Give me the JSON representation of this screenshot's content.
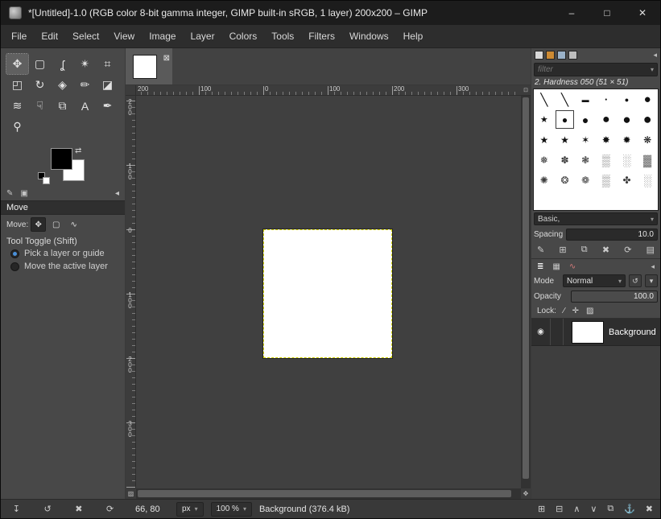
{
  "titlebar": {
    "title": "*[Untitled]-1.0 (RGB color 8-bit gamma integer, GIMP built-in sRGB, 1 layer) 200x200 – GIMP",
    "minimize": "–",
    "maximize": "□",
    "close": "✕"
  },
  "menubar": {
    "items": [
      "File",
      "Edit",
      "Select",
      "View",
      "Image",
      "Layer",
      "Colors",
      "Tools",
      "Filters",
      "Windows",
      "Help"
    ]
  },
  "toolbox": {
    "tools": [
      {
        "name": "move",
        "glyph": "✥"
      },
      {
        "name": "rectangle-select",
        "glyph": "▢"
      },
      {
        "name": "free-select",
        "glyph": "ʆ"
      },
      {
        "name": "fuzzy-select",
        "glyph": "✴"
      },
      {
        "name": "crop",
        "glyph": "⌗"
      },
      {
        "name": "align",
        "glyph": "◰"
      },
      {
        "name": "rotate",
        "glyph": "↻"
      },
      {
        "name": "bucket-fill",
        "glyph": "◈"
      },
      {
        "name": "pencil",
        "glyph": "✏"
      },
      {
        "name": "eraser",
        "glyph": "◪"
      },
      {
        "name": "airbrush",
        "glyph": "≋"
      },
      {
        "name": "smudge",
        "glyph": "☟"
      },
      {
        "name": "clone",
        "glyph": "⧉"
      },
      {
        "name": "text",
        "glyph": "A"
      },
      {
        "name": "ink",
        "glyph": "✒"
      },
      {
        "name": "zoom",
        "glyph": "⚲"
      }
    ],
    "colors": {
      "foreground": "#000000",
      "background": "#ffffff",
      "swap_icon": "⇄"
    },
    "dock_tabs": [
      {
        "name": "tool-options-tab",
        "glyph": "✎"
      },
      {
        "name": "device-status-tab",
        "glyph": "▣"
      }
    ],
    "dock_collapse_icon": "◂",
    "options": {
      "title": "Move",
      "move_label": "Move:",
      "targets": [
        {
          "name": "move-layer",
          "glyph": "✥"
        },
        {
          "name": "move-selection",
          "glyph": "▢"
        },
        {
          "name": "move-path",
          "glyph": "∿"
        }
      ],
      "tool_toggle": "Tool Toggle (Shift)",
      "radios": [
        {
          "label": "Pick a layer or guide",
          "selected": true
        },
        {
          "label": "Move the active layer",
          "selected": false
        }
      ]
    },
    "footer_icons": [
      {
        "name": "save-tool-preset",
        "glyph": "↧"
      },
      {
        "name": "restore-tool-preset",
        "glyph": "↺"
      },
      {
        "name": "delete-tool-preset",
        "glyph": "✖"
      },
      {
        "name": "reset-tool-options",
        "glyph": "⟳"
      }
    ]
  },
  "canvas": {
    "tab_close_icon": "⊠",
    "h_ruler_labels": [
      "200",
      "100",
      "0",
      "100",
      "200",
      "300"
    ],
    "v_ruler_labels": [
      "200",
      "100",
      "0",
      "100",
      "200",
      "300"
    ],
    "zoom_toggle_icon": "⊡",
    "quick_mask_icon": "▨",
    "navigation_icon": "✥"
  },
  "statusbar": {
    "position": "66, 80",
    "unit": "px",
    "zoom": "100 %",
    "message": "Background (376.4 kB)",
    "dropdown_icon": "▾"
  },
  "right_panel": {
    "tabs": [
      {
        "name": "brushes-tab",
        "color": "#d8d8d8"
      },
      {
        "name": "patterns-tab",
        "color": "#cc8a33"
      },
      {
        "name": "fonts-tab",
        "color": "#9ab2c9"
      },
      {
        "name": "document-history-tab",
        "color": "#bdbdbd"
      }
    ],
    "collapse_icon": "◂",
    "filter_placeholder": "filter",
    "brush_title": "2. Hardness 050 (51 × 51)",
    "brush_cells": [
      "╲",
      "╲",
      "▬",
      "●",
      "●",
      "●",
      "★",
      "●",
      "●",
      "●",
      "●",
      "●",
      "★",
      "★",
      "✶",
      "✸",
      "✹",
      "❋",
      "❅",
      "✽",
      "❃",
      "▒",
      "░",
      "▓",
      "✺",
      "❂",
      "❁",
      "▒",
      "✤",
      "░"
    ],
    "tag_value": "Basic,",
    "spacing_label": "Spacing",
    "spacing_value": "10.0",
    "brush_actions": [
      {
        "name": "edit-brush",
        "glyph": "✎"
      },
      {
        "name": "new-brush",
        "glyph": "⊞"
      },
      {
        "name": "duplicate-brush",
        "glyph": "⧉"
      },
      {
        "name": "delete-brush",
        "glyph": "✖"
      },
      {
        "name": "refresh-brushes",
        "glyph": "⟳"
      },
      {
        "name": "open-brush-as-image",
        "glyph": "▤"
      }
    ],
    "dock_tabs": [
      {
        "name": "layers-tab",
        "glyph": "≣"
      },
      {
        "name": "channels-tab",
        "glyph": "▦"
      },
      {
        "name": "paths-tab",
        "glyph": "∿"
      }
    ],
    "layers": {
      "mode_label": "Mode",
      "mode_value": "Normal",
      "mode_switch_icon": "↺",
      "mode_menu_icon": "▾",
      "opacity_label": "Opacity",
      "opacity_value": "100.0",
      "lock_label": "Lock:",
      "lock_icons": [
        {
          "name": "lock-pixels",
          "glyph": "∕"
        },
        {
          "name": "lock-position",
          "glyph": "✛"
        },
        {
          "name": "lock-alpha",
          "glyph": "▨"
        }
      ],
      "visible_icon": "◉",
      "rows": [
        {
          "name": "Background"
        }
      ]
    },
    "layer_actions": [
      {
        "name": "new-layer",
        "glyph": "⊞"
      },
      {
        "name": "new-layer-group",
        "glyph": "⊟"
      },
      {
        "name": "raise-layer",
        "glyph": "∧"
      },
      {
        "name": "lower-layer",
        "glyph": "∨"
      },
      {
        "name": "duplicate-layer",
        "glyph": "⧉"
      },
      {
        "name": "anchor-layer",
        "glyph": "⚓"
      },
      {
        "name": "delete-layer",
        "glyph": "✖"
      }
    ]
  }
}
